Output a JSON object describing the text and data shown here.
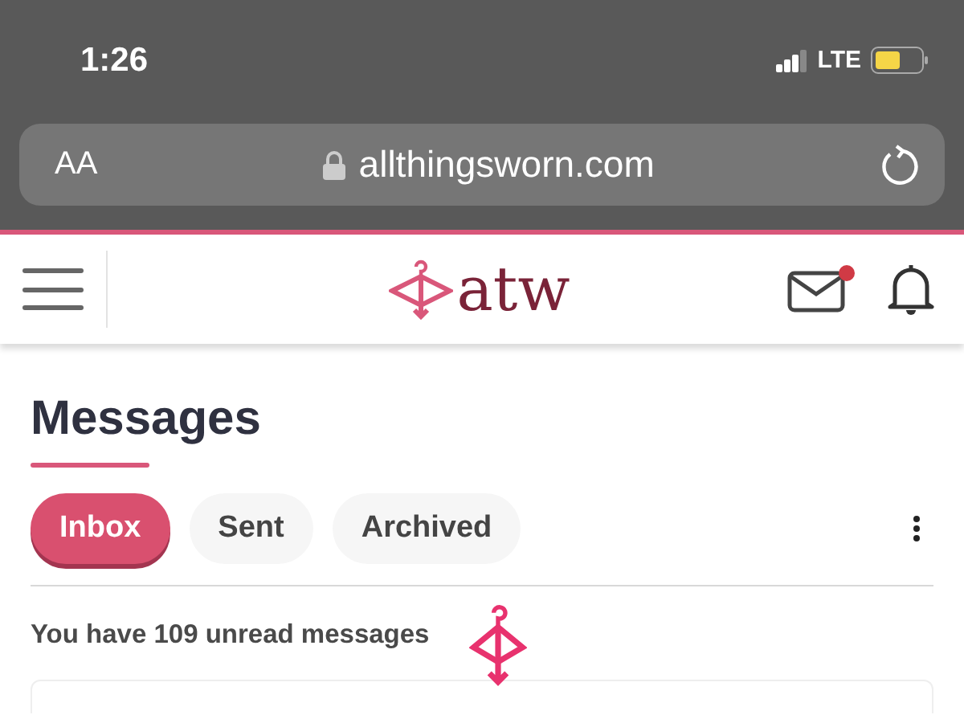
{
  "status_bar": {
    "time": "1:26",
    "network": "LTE"
  },
  "browser": {
    "text_size_button": "AA",
    "url": "allthingsworn.com"
  },
  "header": {
    "logo": "atw",
    "has_unread_mail": true
  },
  "page": {
    "title": "Messages",
    "tabs": [
      {
        "label": "Inbox",
        "selected": true
      },
      {
        "label": "Sent",
        "selected": false
      },
      {
        "label": "Archived",
        "selected": false
      }
    ],
    "unread_text": "You have 109 unread messages",
    "loading": true
  }
}
